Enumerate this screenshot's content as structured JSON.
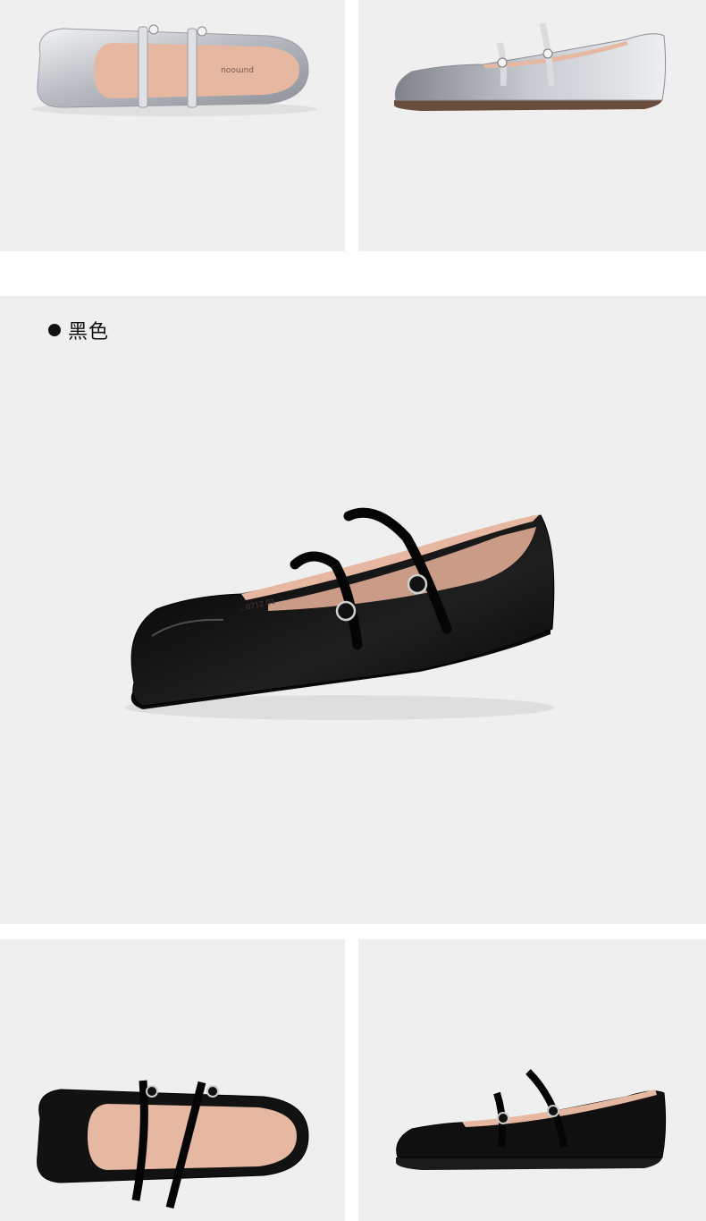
{
  "colors": {
    "panel_bg": "#efefef",
    "page_bg": "#ffffff",
    "silver": "#c9cbcf",
    "black_patent": "#121212",
    "lining": "#e3b5a0"
  },
  "variants": [
    {
      "label": "黑色",
      "marker": "bullet-dot"
    }
  ],
  "images": {
    "silver_top": {
      "name": "silver-mary-jane-top-view",
      "insole_brand": "pumoou"
    },
    "silver_side": {
      "name": "silver-mary-jane-side-view"
    },
    "black_main": {
      "name": "black-mary-jane-three-quarter-view",
      "lining_print": "…0712 01"
    },
    "black_top": {
      "name": "black-mary-jane-top-view"
    },
    "black_side": {
      "name": "black-mary-jane-side-view"
    }
  }
}
